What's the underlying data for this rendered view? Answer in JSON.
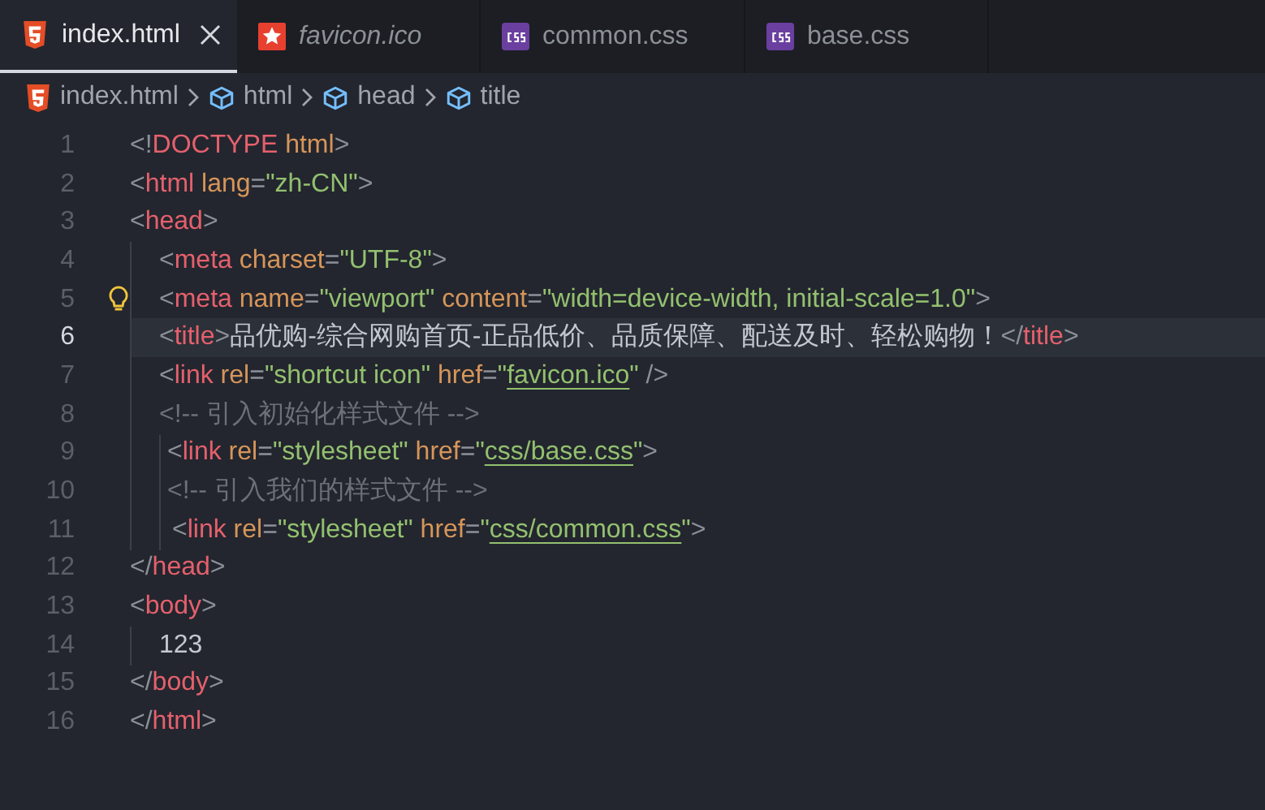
{
  "tabs": [
    {
      "label": "index.html",
      "kind": "html",
      "selected": true,
      "preview": false,
      "closable": true
    },
    {
      "label": "favicon.ico",
      "kind": "image",
      "selected": false,
      "preview": true,
      "closable": false
    },
    {
      "label": "common.css",
      "kind": "css",
      "selected": false,
      "preview": false,
      "closable": false
    },
    {
      "label": "base.css",
      "kind": "css",
      "selected": false,
      "preview": false,
      "closable": false
    }
  ],
  "breadcrumbs": [
    {
      "label": "index.html",
      "kind": "html"
    },
    {
      "label": "html",
      "kind": "element"
    },
    {
      "label": "head",
      "kind": "element"
    },
    {
      "label": "title",
      "kind": "element"
    }
  ],
  "lines": [
    {
      "number": "1",
      "current": false,
      "lightbulb": false,
      "tokens": [
        {
          "kind": "punct",
          "text": "<!"
        },
        {
          "kind": "tag",
          "text": "DOCTYPE"
        },
        {
          "kind": "attr",
          "text": " html"
        },
        {
          "kind": "punct",
          "text": ">"
        }
      ]
    },
    {
      "number": "2",
      "current": false,
      "lightbulb": false,
      "tokens": [
        {
          "kind": "punct",
          "text": "<"
        },
        {
          "kind": "tag",
          "text": "html"
        },
        {
          "kind": "attr",
          "text": " lang"
        },
        {
          "kind": "punct",
          "text": "="
        },
        {
          "kind": "string",
          "text": "\"zh-CN\""
        },
        {
          "kind": "punct",
          "text": ">"
        }
      ]
    },
    {
      "number": "3",
      "current": false,
      "lightbulb": false,
      "tokens": [
        {
          "kind": "punct",
          "text": "<"
        },
        {
          "kind": "tag",
          "text": "head"
        },
        {
          "kind": "punct",
          "text": ">"
        }
      ]
    },
    {
      "number": "4",
      "current": false,
      "lightbulb": false,
      "tokens": [
        {
          "kind": "punct",
          "text": "  <"
        },
        {
          "kind": "tag",
          "text": "meta"
        },
        {
          "kind": "attr",
          "text": " charset"
        },
        {
          "kind": "punct",
          "text": "="
        },
        {
          "kind": "string",
          "text": "\"UTF-8\""
        },
        {
          "kind": "punct",
          "text": ">"
        }
      ]
    },
    {
      "number": "5",
      "current": false,
      "lightbulb": true,
      "tokens": [
        {
          "kind": "punct",
          "text": "  <"
        },
        {
          "kind": "tag",
          "text": "meta"
        },
        {
          "kind": "attr",
          "text": " name"
        },
        {
          "kind": "punct",
          "text": "="
        },
        {
          "kind": "string",
          "text": "\"viewport\""
        },
        {
          "kind": "attr",
          "text": " content"
        },
        {
          "kind": "punct",
          "text": "="
        },
        {
          "kind": "string",
          "text": "\"width=device-width, initial-scale=1.0\""
        },
        {
          "kind": "punct",
          "text": ">"
        }
      ]
    },
    {
      "number": "6",
      "current": true,
      "lightbulb": false,
      "tokens": [
        {
          "kind": "punct",
          "text": "  <"
        },
        {
          "kind": "tag",
          "text": "title"
        },
        {
          "kind": "punct",
          "text": ">"
        },
        {
          "kind": "text",
          "text": "品优购-综合网购首页-正品低价、品质保障、配送及时、轻松购物！"
        },
        {
          "kind": "punct",
          "text": "</"
        },
        {
          "kind": "tag",
          "text": "title"
        },
        {
          "kind": "punct",
          "text": ">"
        }
      ]
    },
    {
      "number": "7",
      "current": false,
      "lightbulb": false,
      "tokens": [
        {
          "kind": "punct",
          "text": "  <"
        },
        {
          "kind": "tag",
          "text": "link"
        },
        {
          "kind": "attr",
          "text": " rel"
        },
        {
          "kind": "punct",
          "text": "="
        },
        {
          "kind": "string",
          "text": "\"shortcut icon\""
        },
        {
          "kind": "attr",
          "text": " href"
        },
        {
          "kind": "punct",
          "text": "="
        },
        {
          "kind": "string",
          "text": "\""
        },
        {
          "kind": "link",
          "text": "favicon.ico"
        },
        {
          "kind": "string",
          "text": "\""
        },
        {
          "kind": "punct",
          "text": " />"
        }
      ]
    },
    {
      "number": "8",
      "current": false,
      "lightbulb": false,
      "tokens": [
        {
          "kind": "comment",
          "text": "  <!-- 引入初始化样式文件 -->"
        }
      ]
    },
    {
      "number": "9",
      "current": false,
      "lightbulb": false,
      "tokens": [
        {
          "kind": "punct",
          "text": "   <"
        },
        {
          "kind": "tag",
          "text": "link"
        },
        {
          "kind": "attr",
          "text": " rel"
        },
        {
          "kind": "punct",
          "text": "="
        },
        {
          "kind": "string",
          "text": "\"stylesheet\""
        },
        {
          "kind": "attr",
          "text": " href"
        },
        {
          "kind": "punct",
          "text": "="
        },
        {
          "kind": "string",
          "text": "\""
        },
        {
          "kind": "link",
          "text": "css/base.css"
        },
        {
          "kind": "string",
          "text": "\""
        },
        {
          "kind": "punct",
          "text": ">"
        }
      ]
    },
    {
      "number": "10",
      "current": false,
      "lightbulb": false,
      "tokens": [
        {
          "kind": "comment",
          "text": "   <!-- 引入我们的样式文件 -->"
        }
      ]
    },
    {
      "number": "11",
      "current": false,
      "lightbulb": false,
      "tokens": [
        {
          "kind": "punct",
          "text": "    <"
        },
        {
          "kind": "tag",
          "text": "link"
        },
        {
          "kind": "attr",
          "text": " rel"
        },
        {
          "kind": "punct",
          "text": "="
        },
        {
          "kind": "string",
          "text": "\"stylesheet\""
        },
        {
          "kind": "attr",
          "text": " href"
        },
        {
          "kind": "punct",
          "text": "="
        },
        {
          "kind": "string",
          "text": "\""
        },
        {
          "kind": "link",
          "text": "css/common.css"
        },
        {
          "kind": "string",
          "text": "\""
        },
        {
          "kind": "punct",
          "text": ">"
        }
      ]
    },
    {
      "number": "12",
      "current": false,
      "lightbulb": false,
      "tokens": [
        {
          "kind": "punct",
          "text": "</"
        },
        {
          "kind": "tag",
          "text": "head"
        },
        {
          "kind": "punct",
          "text": ">"
        }
      ]
    },
    {
      "number": "13",
      "current": false,
      "lightbulb": false,
      "tokens": [
        {
          "kind": "punct",
          "text": "<"
        },
        {
          "kind": "tag",
          "text": "body"
        },
        {
          "kind": "punct",
          "text": ">"
        }
      ]
    },
    {
      "number": "14",
      "current": false,
      "lightbulb": false,
      "tokens": [
        {
          "kind": "text",
          "text": "  123"
        }
      ]
    },
    {
      "number": "15",
      "current": false,
      "lightbulb": false,
      "tokens": [
        {
          "kind": "punct",
          "text": "</"
        },
        {
          "kind": "tag",
          "text": "body"
        },
        {
          "kind": "punct",
          "text": ">"
        }
      ]
    },
    {
      "number": "16",
      "current": false,
      "lightbulb": false,
      "tokens": [
        {
          "kind": "punct",
          "text": "</"
        },
        {
          "kind": "tag",
          "text": "html"
        },
        {
          "kind": "punct",
          "text": ">"
        }
      ]
    }
  ]
}
